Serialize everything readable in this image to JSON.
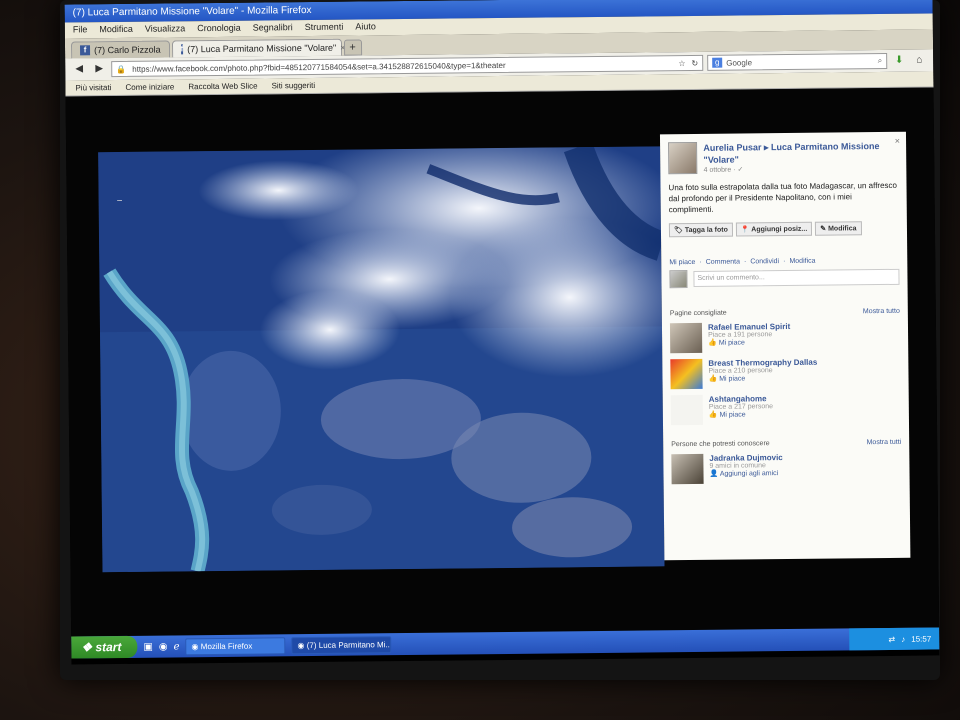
{
  "window": {
    "title": "(7) Luca Parmitano Missione \"Volare\" - Mozilla Firefox"
  },
  "menu": [
    "File",
    "Modifica",
    "Visualizza",
    "Cronologia",
    "Segnalibri",
    "Strumenti",
    "Aiuto"
  ],
  "tabs": [
    {
      "label": "(7) Carlo Pizzola"
    },
    {
      "label": "(7) Luca Parmitano Missione \"Volare\""
    }
  ],
  "nav": {
    "url": "https://www.facebook.com/photo.php?fbid=485120771584054&set=a.341528872615040&type=1&theater",
    "search_placeholder": "Google"
  },
  "bookmarks": [
    "Più visitati",
    "Come iniziare",
    "Raccolta Web Slice",
    "Siti suggeriti"
  ],
  "sidebar": {
    "author": "Aurelia Pusar",
    "arrow": "▸",
    "target": "Luca Parmitano Missione \"Volare\"",
    "sub": "4 ottobre · ✓",
    "caption": "Una foto sulla estrapolata dalla tua foto Madagascar, un affresco dal profondo per il Presidente Napolitano, con i miei complimenti.",
    "buttons": [
      "Tagga la foto",
      "Aggiungi posiz...",
      "Modifica"
    ],
    "actions": [
      "Mi piace",
      "Commenta",
      "Condividi",
      "Modifica"
    ],
    "comment_placeholder": "Scrivi un commento...",
    "suggested_title": "Pagine consigliate",
    "suggested_all": "Mostra tutto",
    "suggested": [
      {
        "name": "Rafael Emanuel Spirit",
        "meta": "Piace a 191 persone",
        "like": "Mi piace"
      },
      {
        "name": "Breast Thermography Dallas",
        "meta": "Piace a 210 persone",
        "like": "Mi piace"
      },
      {
        "name": "Ashtangahome",
        "meta": "Piace a 217 persone",
        "like": "Mi piace"
      }
    ],
    "people_title": "Persone che potresti conoscere",
    "people_all": "Mostra tutti",
    "people": [
      {
        "name": "Jadranka Dujmovic",
        "meta": "9 amici in comune",
        "add": "Aggiungi agli amici"
      }
    ]
  },
  "taskbar": {
    "start": "start",
    "tasks": [
      "Mozilla Firefox",
      "(7) Luca Parmitano Mi..."
    ],
    "clock": "15:57"
  }
}
